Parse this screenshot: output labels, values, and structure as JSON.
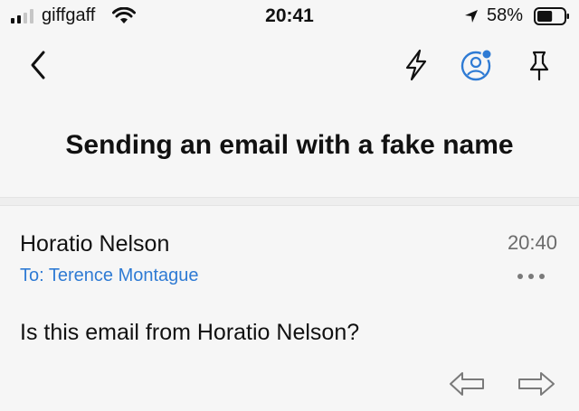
{
  "status_bar": {
    "carrier": "giffgaff",
    "time": "20:41",
    "battery_percent": "58%",
    "battery_level": 0.58,
    "signal_bars_active": 2,
    "icons": [
      "signal-icon",
      "wifi-icon",
      "location-arrow-icon",
      "battery-icon"
    ]
  },
  "nav": {
    "icons": [
      "chevron-left-icon",
      "lightning-bolt-icon",
      "profile-icon",
      "pin-icon"
    ],
    "accent_color": "#2f7bd4"
  },
  "email": {
    "subject": "Sending an email with a fake name",
    "sender": "Horatio Nelson",
    "time": "20:40",
    "to_line": "To: Terence Montague",
    "body": "Is this email from Horatio Nelson?"
  },
  "actions": {
    "icons": [
      "more-dots-icon",
      "reply-icon",
      "forward-icon"
    ]
  }
}
